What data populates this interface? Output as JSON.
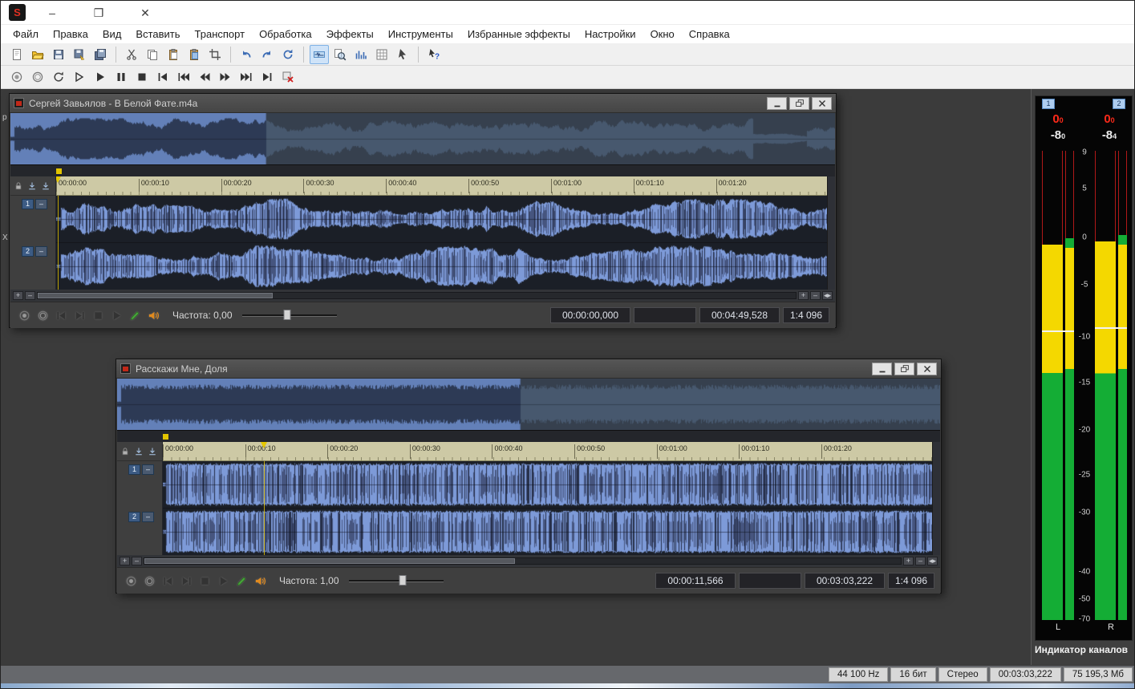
{
  "app": {
    "icon_letter": "S",
    "window_controls": {
      "minimize": "–",
      "maximize": "❒",
      "close": "✕"
    }
  },
  "menu": [
    "Файл",
    "Правка",
    "Вид",
    "Вставить",
    "Транспорт",
    "Обработка",
    "Эффекты",
    "Инструменты",
    "Избранные эффекты",
    "Настройки",
    "Окно",
    "Справка"
  ],
  "toolbar_main": [
    "new",
    "open",
    "save",
    "save-as",
    "save-all",
    "sep",
    "cut",
    "copy",
    "paste",
    "paste-mix",
    "trim",
    "sep",
    "undo",
    "redo",
    "repeat",
    "sep",
    "edit-tool",
    "magnify",
    "spectrum",
    "statistics",
    "pointer",
    "sep",
    "help-cursor"
  ],
  "toolbar_transport": [
    "record",
    "loop-record",
    "loop-playback",
    "play-all",
    "play",
    "pause",
    "stop",
    "go-start",
    "rewind-all",
    "rewind",
    "forward",
    "forward-all",
    "go-end",
    "stop-preview"
  ],
  "window_transport_icons": [
    "record",
    "loop-record",
    "go-start",
    "go-end",
    "stop",
    "play",
    "pencil",
    "scrub-speaker"
  ],
  "windows": [
    {
      "title": "Сергей Завьялов - В Белой Фате.m4a",
      "ruler": [
        "00:00:00",
        "00:00:10",
        "00:00:20",
        "00:00:30",
        "00:00:40",
        "00:00:50",
        "00:01:00",
        "00:01:10",
        "00:01:20"
      ],
      "channels": [
        "1",
        "2"
      ],
      "rate_label": "Частота: 0,00",
      "rate_value": 0.48,
      "cursor_frac": 0.002,
      "view_frac": 0.31,
      "profile": "varied",
      "outro": true,
      "seed": 7,
      "fields": {
        "position": "00:00:00,000",
        "selection": "",
        "length": "00:04:49,528",
        "zoom": "1:4 096"
      }
    },
    {
      "title": "Расскажи Мне, Доля",
      "ruler": [
        "00:00:00",
        "00:00:10",
        "00:00:20",
        "00:00:30",
        "00:00:40",
        "00:00:50",
        "00:01:00",
        "00:01:10",
        "00:01:20"
      ],
      "channels": [
        "1",
        "2"
      ],
      "rate_label": "Частота: 1,00",
      "rate_value": 0.57,
      "cursor_frac": 0.131,
      "view_frac": 0.49,
      "profile": "dense",
      "outro": false,
      "seed": 23,
      "fields": {
        "position": "00:00:11,566",
        "selection": "",
        "length": "00:03:03,222",
        "zoom": "1:4 096"
      }
    }
  ],
  "meters": {
    "tabs": [
      "1",
      "2"
    ],
    "channels": [
      {
        "clip_main": "0",
        "clip_dec": "0",
        "peak_main": "-8",
        "peak_dec": "0",
        "bar_top": 0.2,
        "peak_line": 0.383,
        "bottom_label": "L"
      },
      {
        "clip_main": "0",
        "clip_dec": "0",
        "peak_main": "-8",
        "peak_dec": "4",
        "bar_top": 0.193,
        "peak_line": 0.376,
        "bottom_label": "R"
      }
    ],
    "yellow_until": 0.474,
    "scale": [
      {
        "label": "9",
        "frac": 0.004
      },
      {
        "label": "5",
        "frac": 0.08
      },
      {
        "label": "0",
        "frac": 0.185
      },
      {
        "label": "-5",
        "frac": 0.285
      },
      {
        "label": "-10",
        "frac": 0.397
      },
      {
        "label": "-15",
        "frac": 0.494
      },
      {
        "label": "-20",
        "frac": 0.595
      },
      {
        "label": "-25",
        "frac": 0.691
      },
      {
        "label": "-30",
        "frac": 0.771
      },
      {
        "label": "-40",
        "frac": 0.898
      },
      {
        "label": "-50",
        "frac": 0.955
      },
      {
        "label": "-70",
        "frac": 0.998
      }
    ],
    "caption": "Индикатор каналов"
  },
  "statusbar": [
    "44 100 Hz",
    "16 бит",
    "Стерео",
    "00:03:03,222",
    "75 195,3 Мб"
  ],
  "edge_labels": [
    "р",
    "X"
  ]
}
